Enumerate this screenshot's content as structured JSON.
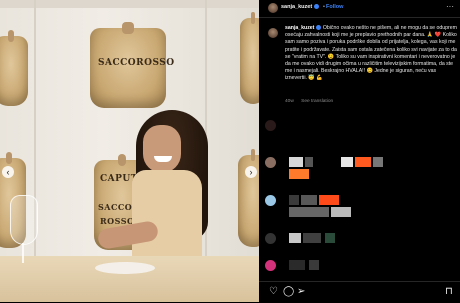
{
  "post": {
    "username": "sanja_kuzet",
    "follow_label": "Follow",
    "separator": "•",
    "more_label": "···",
    "caption_username": "sanja_kuzet",
    "caption_text": " Obično ovako nešto ne pišem, ali ne mogu da se oduprem osećaju zahvalnosti koji me je preplavio prethodnih par dana. 🙏 ❤️ Koliko sam samo poziva i poruka podrške dobila od prijatelja, kolega, vas koji me pratite i podržavate. Zaista sam ostala zatečena koliko svi navijate za to da se \"vratim na TV\". 😉 Toliko su vam inspirativni komentari i neverovatno je da me ovako vidi drugim očima u različitim televizijskim formatima, da ste me i nasmejali. Beskrajno HVALA!! 😊 Jedne je siguran, neću vas iznevertii. 😇 💪",
    "time_ago": "40w",
    "see_translation": "See translation"
  },
  "photo": {
    "sack_labels": [
      "SACCOROSSO",
      "CAPUTO",
      "SACCO",
      "ROSSO",
      "CAPUTO"
    ]
  },
  "actions": {
    "like_icon": "heart-icon",
    "comment_icon": "comment-icon",
    "share_icon": "share-icon",
    "save_icon": "bookmark-icon"
  },
  "colors": {
    "accent": "#3b82f6",
    "background": "#000000"
  }
}
